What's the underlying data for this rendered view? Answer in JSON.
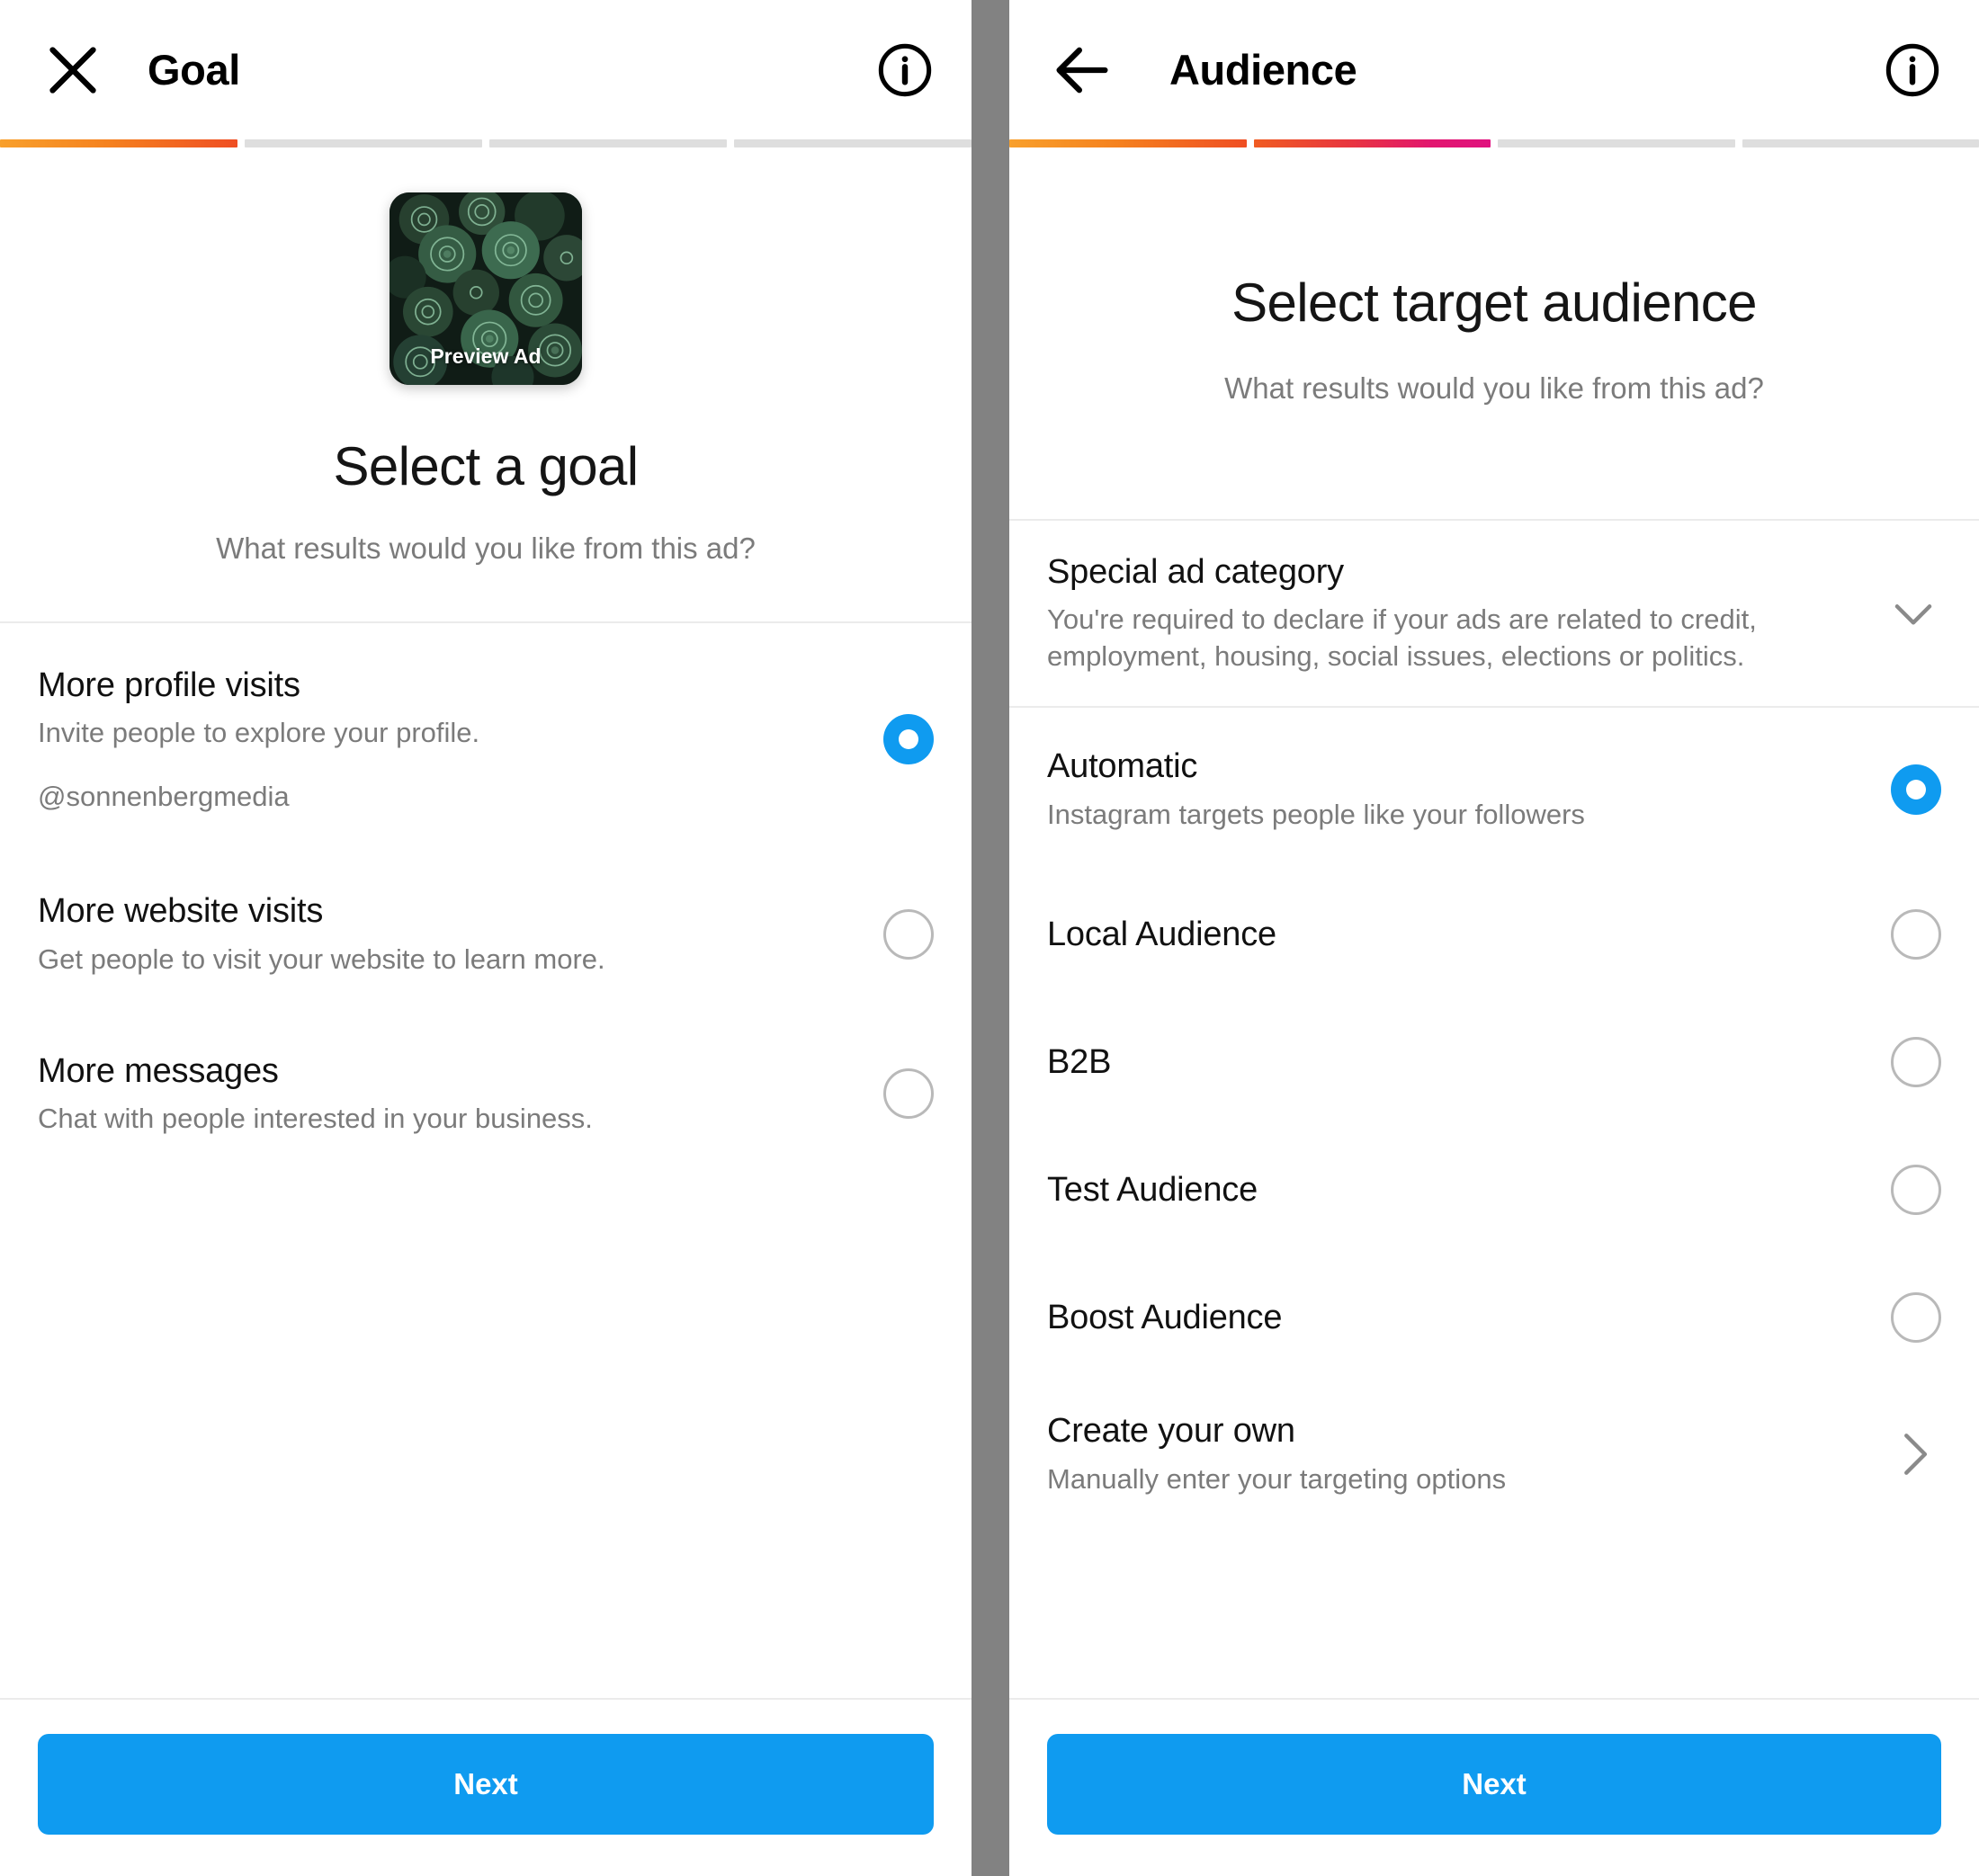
{
  "colors": {
    "accent_blue": "#0f9bf0",
    "progress_orange_start": "#f8a02c",
    "progress_orange_end": "#ef4e23",
    "progress_pink_end": "#e0127f",
    "divider_gray": "#828282",
    "muted_text": "#7b7b7b"
  },
  "left_screen": {
    "topbar": {
      "close_icon": "close-icon",
      "title": "Goal",
      "info_icon": "info-icon"
    },
    "progress": {
      "segments": 4,
      "filled": 1
    },
    "preview": {
      "label": "Preview Ad",
      "icon": "ad-thumbnail-succulents"
    },
    "hero": {
      "title": "Select a goal",
      "subtitle": "What results would you like from this ad?"
    },
    "options": [
      {
        "title": "More profile visits",
        "subtitle": "Invite people to explore your profile.",
        "extra": "@sonnenbergmedia",
        "selected": true
      },
      {
        "title": "More website visits",
        "subtitle": "Get people to visit your website to learn more.",
        "extra": "",
        "selected": false
      },
      {
        "title": "More messages",
        "subtitle": "Chat with people interested in your business.",
        "extra": "",
        "selected": false
      }
    ],
    "footer": {
      "next_label": "Next"
    }
  },
  "right_screen": {
    "topbar": {
      "back_icon": "arrow-left-icon",
      "title": "Audience",
      "info_icon": "info-icon"
    },
    "progress": {
      "segments": 4,
      "filled": 2
    },
    "hero": {
      "title": "Select target audience",
      "subtitle": "What results would you like from this ad?"
    },
    "special_ad_category": {
      "title": "Special ad category",
      "subtitle": "You're required to declare if your ads are related to credit, employment, housing, social issues, elections or politics.",
      "icon": "chevron-down-icon"
    },
    "audiences": [
      {
        "title": "Automatic",
        "subtitle": "Instagram targets people like your followers",
        "selected": true
      },
      {
        "title": "Local Audience",
        "subtitle": "",
        "selected": false
      },
      {
        "title": "B2B",
        "subtitle": "",
        "selected": false
      },
      {
        "title": "Test Audience",
        "subtitle": "",
        "selected": false
      },
      {
        "title": "Boost Audience",
        "subtitle": "",
        "selected": false
      }
    ],
    "create_your_own": {
      "title": "Create your own",
      "subtitle": "Manually enter your targeting options",
      "icon": "chevron-right-icon"
    },
    "footer": {
      "next_label": "Next"
    }
  }
}
